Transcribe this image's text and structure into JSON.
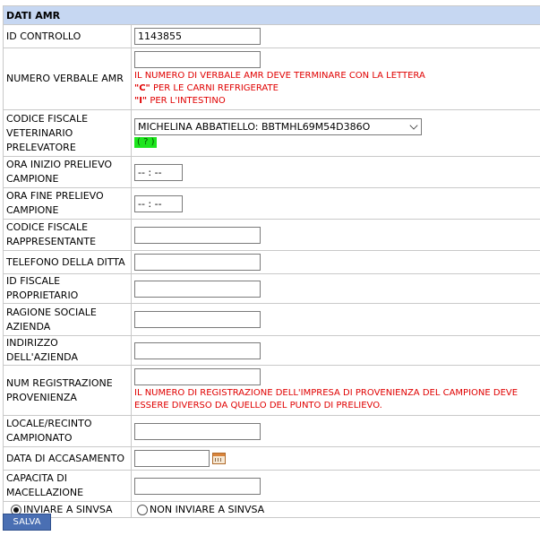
{
  "section_title": "DATI AMR",
  "fields": {
    "id_controllo": {
      "label": "ID CONTROLLO",
      "value": "1143855"
    },
    "numero_verbale": {
      "label": "NUMERO VERBALE AMR",
      "value": "",
      "warning_line1": "IL NUMERO DI VERBALE AMR DEVE TERMINARE CON LA LETTERA",
      "warning_c_letter": "\"C\"",
      "warning_c_text": " PER LE CARNI REFRIGERATE",
      "warning_i_letter": "\"I\"",
      "warning_i_text": " PER L'INTESTINO"
    },
    "codice_fiscale_vet": {
      "label": "CODICE FISCALE VETERINARIO PRELEVATORE",
      "selected": "MICHELINA ABBATIELLO: BBTMHL69M54D386O",
      "help": "( ? )"
    },
    "ora_inizio": {
      "label": "ORA INIZIO PRELIEVO CAMPIONE",
      "value": "-- : --"
    },
    "ora_fine": {
      "label": "ORA FINE PRELIEVO CAMPIONE",
      "value": "-- : --"
    },
    "cf_rappresentante": {
      "label": "CODICE FISCALE RAPPRESENTANTE",
      "value": ""
    },
    "telefono": {
      "label": "TELEFONO DELLA DITTA",
      "value": ""
    },
    "id_fiscale": {
      "label": "ID FISCALE PROPRIETARIO",
      "value": ""
    },
    "ragione_sociale": {
      "label": "RAGIONE SOCIALE AZIENDA",
      "value": ""
    },
    "indirizzo": {
      "label": "INDIRIZZO DELL'AZIENDA",
      "value": ""
    },
    "num_registrazione": {
      "label": "NUM REGISTRAZIONE PROVENIENZA",
      "value": "",
      "warning": "IL NUMERO DI REGISTRAZIONE DELL'IMPRESA DI PROVENIENZA DEL CAMPIONE DEVE ESSERE DIVERSO DA QUELLO DEL PUNTO DI PRELIEVO."
    },
    "locale": {
      "label": "LOCALE/RECINTO CAMPIONATO",
      "value": ""
    },
    "data_accasamento": {
      "label": "DATA DI ACCASAMENTO",
      "value": ""
    },
    "capacita": {
      "label": "CAPACITA DI MACELLAZIONE",
      "value": ""
    }
  },
  "radio": {
    "invia_label": "INVIARE A SINVSA",
    "non_invia_label": "NON INVIARE A SINVSA",
    "selected": "invia"
  },
  "buttons": {
    "save": "SALVA"
  }
}
